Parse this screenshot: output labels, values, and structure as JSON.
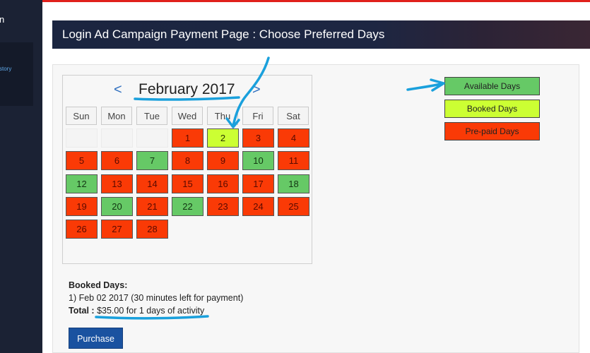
{
  "sidebar": {
    "fragment_top": "n",
    "fragment_sub": "story"
  },
  "header": {
    "title": "Login Ad Campaign Payment Page : Choose Preferred Days"
  },
  "calendar": {
    "month_label": "February 2017",
    "prev_label": "<",
    "next_label": ">",
    "weekdays": [
      "Sun",
      "Mon",
      "Tue",
      "Wed",
      "Thu",
      "Fri",
      "Sat"
    ],
    "colors": {
      "prepaid": "#fa3a06",
      "available": "#66c966",
      "booked": "#ccff33"
    },
    "days": [
      {
        "n": "1",
        "status": "prepaid"
      },
      {
        "n": "2",
        "status": "booked"
      },
      {
        "n": "3",
        "status": "prepaid"
      },
      {
        "n": "4",
        "status": "prepaid"
      },
      {
        "n": "5",
        "status": "prepaid"
      },
      {
        "n": "6",
        "status": "prepaid"
      },
      {
        "n": "7",
        "status": "available"
      },
      {
        "n": "8",
        "status": "prepaid"
      },
      {
        "n": "9",
        "status": "prepaid"
      },
      {
        "n": "10",
        "status": "available"
      },
      {
        "n": "11",
        "status": "prepaid"
      },
      {
        "n": "12",
        "status": "available"
      },
      {
        "n": "13",
        "status": "prepaid"
      },
      {
        "n": "14",
        "status": "prepaid"
      },
      {
        "n": "15",
        "status": "prepaid"
      },
      {
        "n": "16",
        "status": "prepaid"
      },
      {
        "n": "17",
        "status": "prepaid"
      },
      {
        "n": "18",
        "status": "available"
      },
      {
        "n": "19",
        "status": "prepaid"
      },
      {
        "n": "20",
        "status": "available"
      },
      {
        "n": "21",
        "status": "prepaid"
      },
      {
        "n": "22",
        "status": "available"
      },
      {
        "n": "23",
        "status": "prepaid"
      },
      {
        "n": "24",
        "status": "prepaid"
      },
      {
        "n": "25",
        "status": "prepaid"
      },
      {
        "n": "26",
        "status": "prepaid"
      },
      {
        "n": "27",
        "status": "prepaid"
      },
      {
        "n": "28",
        "status": "prepaid"
      }
    ]
  },
  "legend": {
    "available": "Available Days",
    "booked": "Booked Days",
    "prepaid": "Pre-paid Days"
  },
  "booking": {
    "heading": "Booked Days:",
    "item": "1) Feb 02 2017 (30 minutes left for payment)",
    "total_label": "Total :",
    "total_value": "$35.00 for 1 days of activity"
  },
  "actions": {
    "purchase": "Purchase"
  },
  "annotation_color": "#1aa0dc"
}
